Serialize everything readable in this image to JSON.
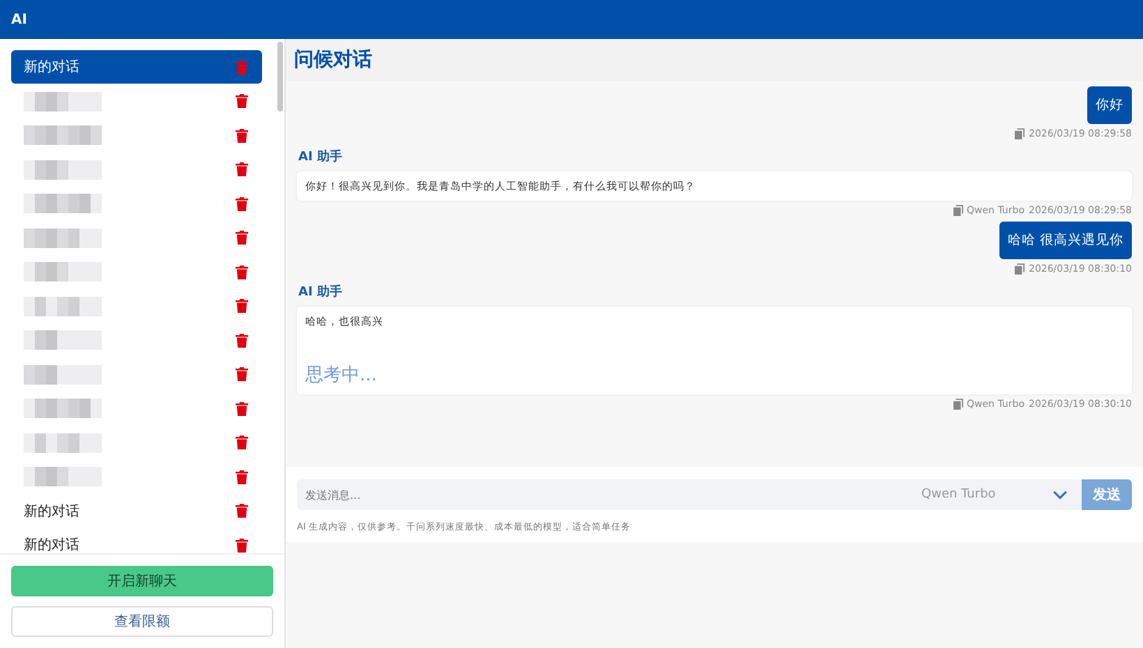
{
  "app_bar": {
    "title": "AI"
  },
  "sidebar": {
    "items": [
      {
        "kind": "text",
        "label": "新的对话",
        "selected": true
      },
      {
        "kind": "redacted",
        "selected": false
      },
      {
        "kind": "redacted",
        "selected": false
      },
      {
        "kind": "redacted",
        "selected": false
      },
      {
        "kind": "redacted",
        "selected": false
      },
      {
        "kind": "redacted",
        "selected": false
      },
      {
        "kind": "redacted",
        "selected": false
      },
      {
        "kind": "redacted",
        "selected": false
      },
      {
        "kind": "redacted",
        "selected": false
      },
      {
        "kind": "redacted",
        "selected": false
      },
      {
        "kind": "redacted",
        "selected": false
      },
      {
        "kind": "redacted",
        "selected": false
      },
      {
        "kind": "redacted",
        "selected": false
      },
      {
        "kind": "text",
        "label": "新的对话",
        "selected": false
      },
      {
        "kind": "text",
        "label": "新的对话",
        "selected": false
      }
    ],
    "new_chat_button": "开启新聊天",
    "quota_button": "查看限额"
  },
  "chat": {
    "title": "问候对话",
    "messages": [
      {
        "kind": "user",
        "text": "你好",
        "time": "2026/03/19 08:29:58"
      },
      {
        "kind": "assistant",
        "sender": "AI 助手",
        "text": "你好！很高兴见到你。我是青岛中学的人工智能助手，有什么我可以帮你的吗？",
        "model": "Qwen Turbo",
        "time": "2026/03/19 08:29:58"
      },
      {
        "kind": "user",
        "text": "哈哈 很高兴遇见你",
        "time": "2026/03/19 08:30:10"
      },
      {
        "kind": "assistant",
        "sender": "AI 助手",
        "text": "哈哈，也很高兴",
        "status": "思考中...",
        "model": "Qwen Turbo",
        "time": "2026/03/19 08:30:10"
      }
    ]
  },
  "composer": {
    "placeholder": "发送消息...",
    "model": "Qwen Turbo",
    "send_button": "发送",
    "disclaimer": "AI 生成内容，仅供参考。千问系列速度最快、成本最低的模型，适合简单任务"
  }
}
